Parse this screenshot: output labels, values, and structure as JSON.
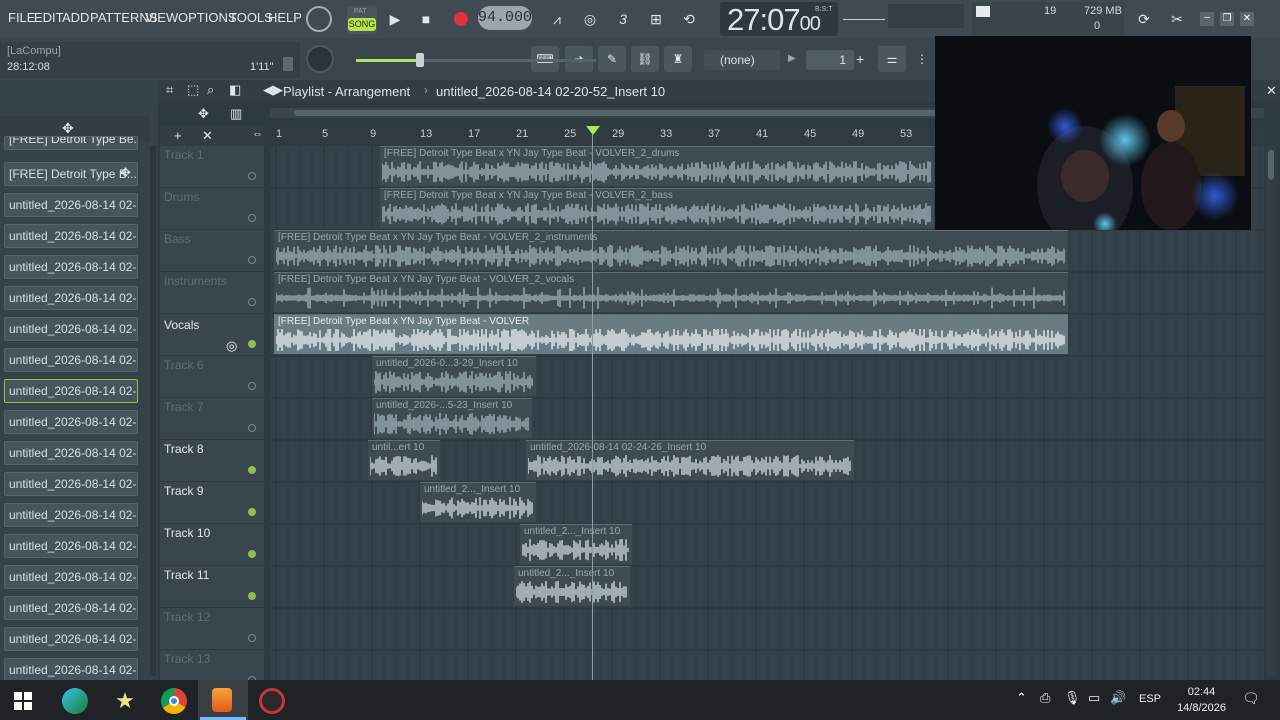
{
  "menu": [
    "FILE",
    "EDIT",
    "ADD",
    "PATTERNS",
    "VIEW",
    "OPTIONS",
    "TOOLS",
    "HELP"
  ],
  "transport": {
    "mode_pat": "PAT",
    "mode_song": "SONG",
    "tempo": "94.000",
    "song_time": "27:07",
    "song_time_sub": "00",
    "song_time_unit": "B:S:T"
  },
  "monitor": {
    "cpu": "19",
    "ram": "729 MB",
    "poly": "0"
  },
  "hint": {
    "user": "[LaCompu]",
    "time": "28:12:08",
    "length": "1'11\""
  },
  "toolbar2": {
    "snap": "(none)",
    "pattern_number": "1"
  },
  "playlist": {
    "title": "Playlist - Arrangement",
    "path": "untitled_2026-08-14 02-20-52_Insert 10"
  },
  "browser": {
    "items": [
      "[FREE] Detroit Type Be...",
      "[FREE] Detroit Type B...",
      "untitled_2026-08-14 02-...",
      "untitled_2026-08-14 02-...",
      "untitled_2026-08-14 02-...",
      "untitled_2026-08-14 02-...",
      "untitled_2026-08-14 02-...",
      "untitled_2026-08-14 02-...",
      "untitled_2026-08-14 02-...",
      "untitled_2026-08-14 02-...",
      "untitled_2026-08-14 02-...",
      "untitled_2026-08-14 02-...",
      "untitled_2026-08-14 02-...",
      "untitled_2026-08-14 02-...",
      "untitled_2026-08-14 02-...",
      "untitled_2026-08-14 02-...",
      "untitled_2026-08-14 02-...",
      "untitled_2026-08-14 02-..."
    ]
  },
  "ruler": [
    "1",
    "5",
    "9",
    "13",
    "17",
    "21",
    "25",
    "29",
    "33",
    "37",
    "41",
    "45",
    "49",
    "53"
  ],
  "tracks": [
    {
      "name": "Track 1",
      "active": false
    },
    {
      "name": "Drums",
      "active": false
    },
    {
      "name": "Bass",
      "active": false
    },
    {
      "name": "Instruments",
      "active": false
    },
    {
      "name": "Vocals",
      "active": true
    },
    {
      "name": "Track 6",
      "active": false
    },
    {
      "name": "Track 7",
      "active": false
    },
    {
      "name": "Track 8",
      "active": true
    },
    {
      "name": "Track 9",
      "active": true
    },
    {
      "name": "Track 10",
      "active": true
    },
    {
      "name": "Track 11",
      "active": true
    },
    {
      "name": "Track 12",
      "active": false
    },
    {
      "name": "Track 13",
      "active": false
    }
  ],
  "clips": {
    "drums": "[FREE] Detroit Type Beat x YN Jay Type Beat - VOLVER_2_drums",
    "bass": "[FREE] Detroit Type Beat x YN Jay Type Beat - VOLVER_2_bass",
    "instruments": "[FREE] Detroit Type Beat x YN Jay Type Beat - VOLVER_2_instruments",
    "vocals": "[FREE] Detroit Type Beat x YN Jay Type Beat - VOLVER_2_vocals",
    "main": "[FREE] Detroit Type Beat x YN Jay Type Beat - VOLVER",
    "t6": "untitled_2026-0...3-29_Insert 10",
    "t7": "untitled_2026-...5-23_Insert 10",
    "t8a": "until...ert 10",
    "t8b": "untitled_2026-08-14 02-24-26_Insert 10",
    "t9": "untitled_2..._Insert 10",
    "t10": "untitled_2..._Insert 10",
    "t11": "untitled_2..._Insert 10"
  },
  "taskbar": {
    "lang": "ESP",
    "time": "02:44",
    "date": "14/8/2026"
  },
  "colors": {
    "accent_green": "#8bc34a",
    "bg": "#34414a"
  }
}
